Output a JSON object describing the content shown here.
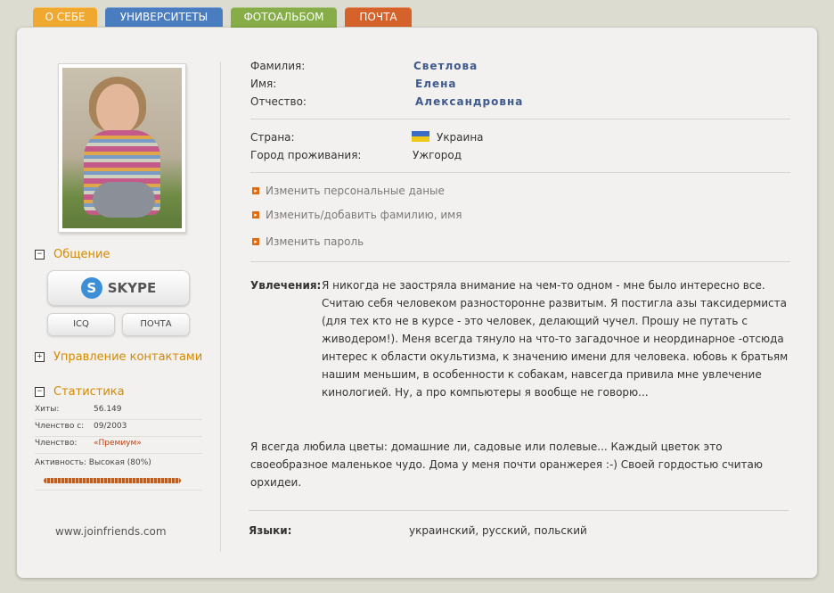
{
  "tabs": [
    {
      "label": "О СЕБЕ",
      "color": "#f0a830"
    },
    {
      "label": "УНИВЕРСИТЕТЫ",
      "color": "#4a7cc0"
    },
    {
      "label": "ФОТОАЛЬБОМ",
      "color": "#86ad48"
    },
    {
      "label": "ПОЧТА",
      "color": "#d4622a"
    }
  ],
  "sidebar": {
    "communication": {
      "label": "Общение",
      "toggle": "−"
    },
    "skype_label": "SKYPE",
    "skype_logo": "S",
    "icq_label": "ICQ",
    "mail_label": "ПОЧТА",
    "contacts": {
      "label": "Управление контактами",
      "toggle": "+"
    },
    "stats": {
      "label": "Статистика",
      "toggle": "−",
      "rows": [
        {
          "label": "Хиты:",
          "value": "56.149"
        },
        {
          "label": "Членство с:",
          "value": "09/2003"
        },
        {
          "label": "Членство:",
          "value": "«Премиум»"
        }
      ],
      "activity": "Активность: Высокая (80%)",
      "activity_percent": 80
    },
    "site": "www.joinfriends.com"
  },
  "profile": {
    "surname_label": "Фамилия:",
    "surname": "Светлова",
    "name_label": "Имя:",
    "name": "Елена",
    "patronymic_label": "Отчество:",
    "patronymic": "Александровна",
    "country_label": "Страна:",
    "country": "Украина",
    "city_label": "Город проживания:",
    "city": "Ужгород"
  },
  "links": [
    "Изменить персональные даные",
    "Изменить/добавить фамилию, имя",
    "Изменить пароль"
  ],
  "hobbies": {
    "label": "Увлечения:",
    "text": "Я никогда не заостряла внимание на чем-то одном - мне было интересно все. Считаю себя человеком разносторонне развитым. Я постигла азы таксидермиста (для тех кто не в курсе - это человек, делающий чучел. Прошу не путать с живодером!). Меня всегда тянуло на что-то загадочное и неординарное -отсюда интерес к области окультизма, к значению имени для человека. юбовь к братьям нашим меньшим, в особенности к собакам, навсегда привила мне увлечение кинологией. Ну, а про компьютеры я вообще не говорю...",
    "text2": "Я всегда любила цветы: домашние ли, садовые или полевые... Каждый цветок это своеобразное маленькое чудо. Дома у меня почти оранжерея :-) Своей гордостью считаю орхидеи."
  },
  "languages": {
    "label": "Языки:",
    "value": "украинский, русский, польский"
  }
}
